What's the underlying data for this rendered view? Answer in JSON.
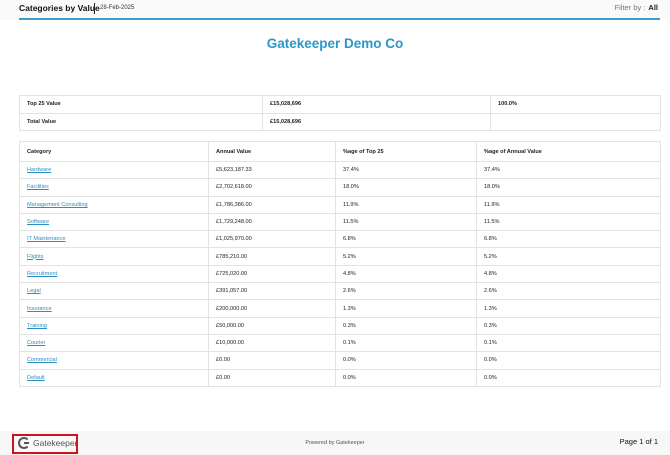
{
  "header": {
    "title": "Categories by Value",
    "date": "28-Feb-2025",
    "filter_label": "Filter by :",
    "filter_value": "All"
  },
  "company": "Gatekeeper Demo Co",
  "summary": {
    "top25": {
      "label": "Top 25 Value",
      "value": "£15,028,696",
      "pct": "100.0%"
    },
    "total": {
      "label": "Total Value",
      "value": "£15,028,696",
      "pct": ""
    }
  },
  "table": {
    "headers": [
      "Category",
      "Annual Value",
      "%age of Top 25",
      "%age of Annual Value"
    ],
    "rows": [
      [
        "Hardware",
        "£5,623,187.33",
        "37.4%",
        "37.4%"
      ],
      [
        "Facilities",
        "£2,702,618.00",
        "18.0%",
        "18.0%"
      ],
      [
        "Management Consulting",
        "£1,786,386.00",
        "11.9%",
        "11.9%"
      ],
      [
        "Software",
        "£1,729,248.00",
        "11.5%",
        "11.5%"
      ],
      [
        "IT Maintenance",
        "£1,025,970.00",
        "6.8%",
        "6.8%"
      ],
      [
        "Flights",
        "£785,210.00",
        "5.2%",
        "5.2%"
      ],
      [
        "Recruitment",
        "£725,020.00",
        "4.8%",
        "4.8%"
      ],
      [
        "Legal",
        "£391,057.00",
        "2.6%",
        "2.6%"
      ],
      [
        "Insurance",
        "£200,000.00",
        "1.3%",
        "1.3%"
      ],
      [
        "Training",
        "£50,000.00",
        "0.3%",
        "0.3%"
      ],
      [
        "Courier",
        "£10,000.00",
        "0.1%",
        "0.1%"
      ],
      [
        "Commercial",
        "£0.00",
        "0.0%",
        "0.0%"
      ],
      [
        "Default",
        "£0.00",
        "0.0%",
        "0.0%"
      ]
    ]
  },
  "footer": {
    "logo_text": "Gatekeeper",
    "powered_by": "Powered by Gatekeeper",
    "page_info": "Page 1 of 1",
    "logo_icon": "g-logo-icon"
  }
}
